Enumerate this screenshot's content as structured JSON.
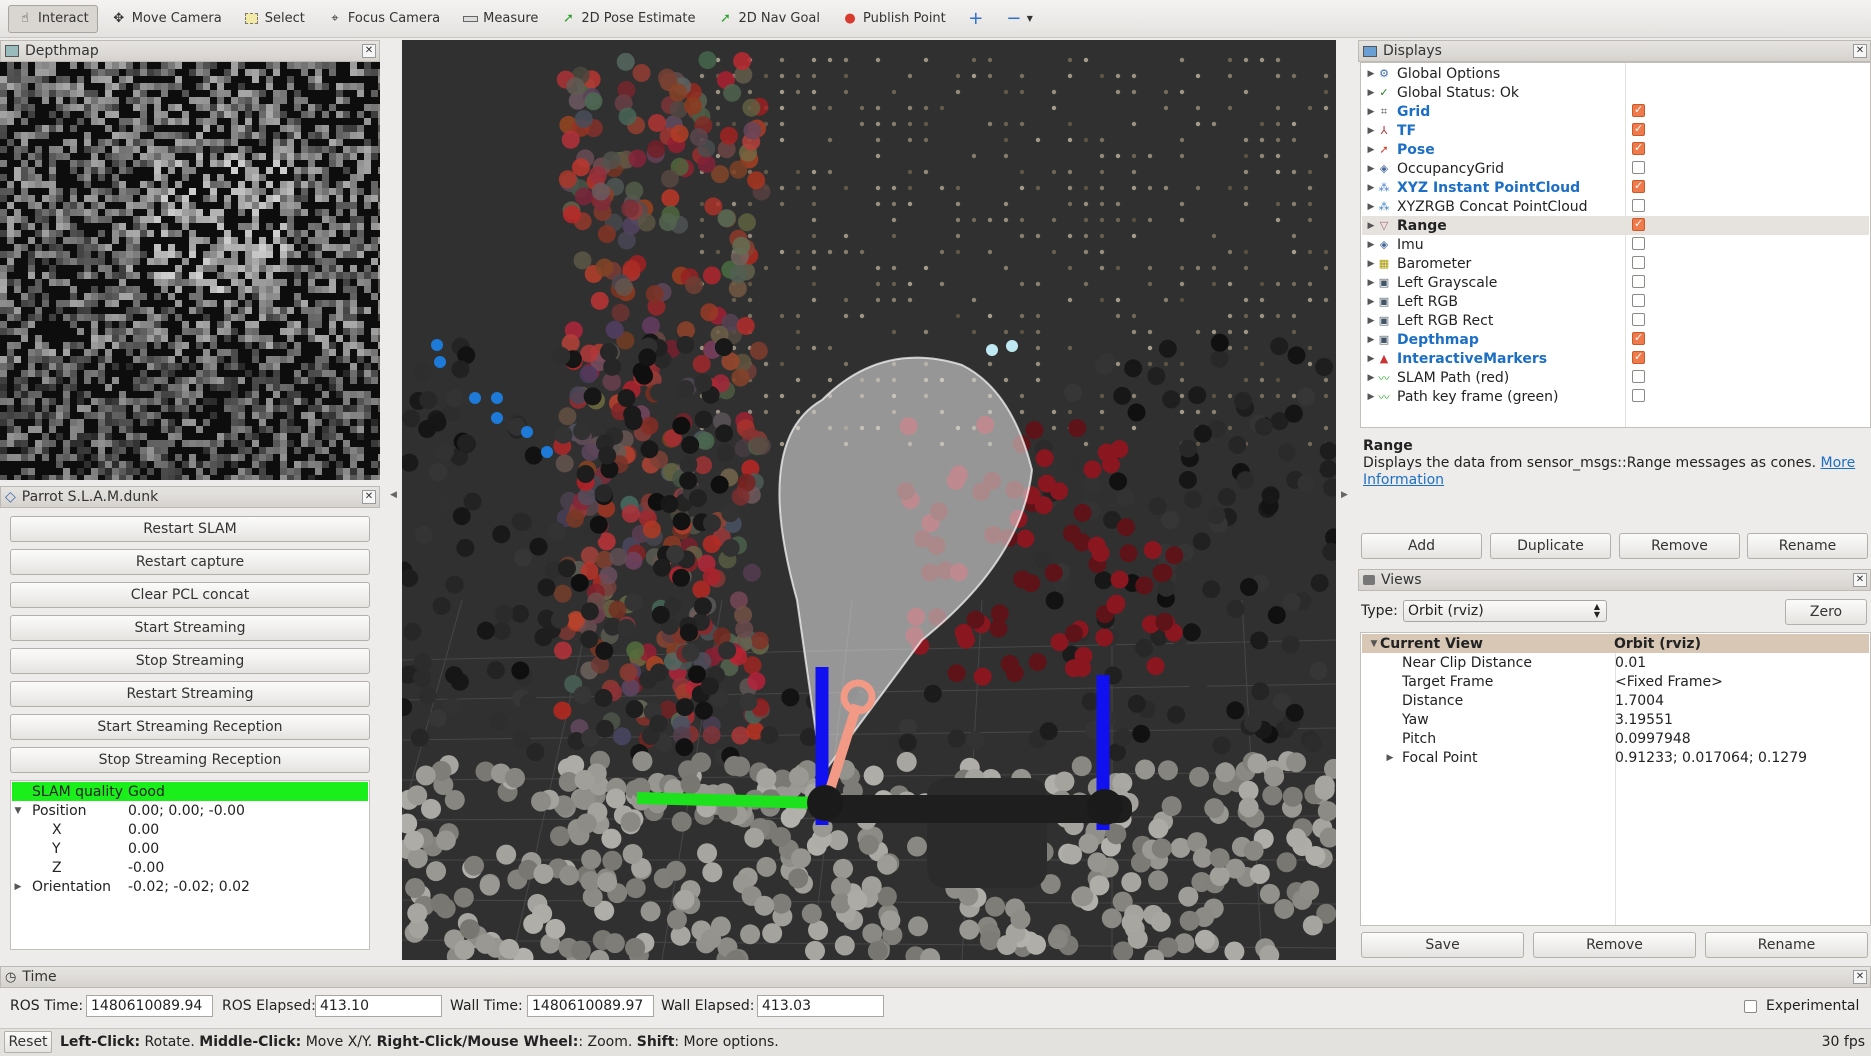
{
  "toolbar": {
    "interact": "Interact",
    "move_camera": "Move Camera",
    "select": "Select",
    "focus_camera": "Focus Camera",
    "measure": "Measure",
    "pose_estimate": "2D Pose Estimate",
    "nav_goal": "2D Nav Goal",
    "publish_point": "Publish Point"
  },
  "depthmap_panel": {
    "title": "Depthmap"
  },
  "slam_panel": {
    "title": "Parrot S.L.A.M.dunk",
    "buttons": [
      "Restart SLAM",
      "Restart capture",
      "Clear PCL concat",
      "Start Streaming",
      "Stop Streaming",
      "Restart Streaming",
      "Start Streaming Reception",
      "Stop Streaming Reception"
    ],
    "tree": [
      {
        "label": "SLAM quality",
        "value": "Good"
      },
      {
        "label": "Position",
        "value": "0.00; 0.00; -0.00"
      },
      {
        "label": "X",
        "value": "0.00"
      },
      {
        "label": "Y",
        "value": "0.00"
      },
      {
        "label": "Z",
        "value": "-0.00"
      },
      {
        "label": "Orientation",
        "value": "-0.02; -0.02; 0.02"
      }
    ]
  },
  "displays": {
    "title": "Displays",
    "items": [
      {
        "label": "Global Options"
      },
      {
        "label": "Global Status: Ok"
      },
      {
        "label": "Grid"
      },
      {
        "label": "TF"
      },
      {
        "label": "Pose"
      },
      {
        "label": "OccupancyGrid"
      },
      {
        "label": "XYZ Instant PointCloud"
      },
      {
        "label": "XYZRGB Concat PointCloud"
      },
      {
        "label": "Range"
      },
      {
        "label": "Imu"
      },
      {
        "label": "Barometer"
      },
      {
        "label": "Left Grayscale"
      },
      {
        "label": "Left RGB"
      },
      {
        "label": "Left RGB Rect"
      },
      {
        "label": "Depthmap"
      },
      {
        "label": "InteractiveMarkers"
      },
      {
        "label": "SLAM Path (red)"
      },
      {
        "label": "Path key frame (green)"
      }
    ],
    "desc_title": "Range",
    "desc_text": "Displays the data from sensor_msgs::Range messages as cones.",
    "desc_link1": "More",
    "desc_link2": "Information",
    "buttons": {
      "add": "Add",
      "duplicate": "Duplicate",
      "remove": "Remove",
      "rename": "Rename"
    }
  },
  "views": {
    "title": "Views",
    "type_label": "Type:",
    "type_value": "Orbit (rviz)",
    "zero": "Zero",
    "header": {
      "name": "Current View",
      "value": "Orbit (rviz)"
    },
    "props": [
      {
        "label": "Near Clip Distance",
        "value": "0.01"
      },
      {
        "label": "Target Frame",
        "value": "<Fixed Frame>"
      },
      {
        "label": "Distance",
        "value": "1.7004"
      },
      {
        "label": "Yaw",
        "value": "3.19551"
      },
      {
        "label": "Pitch",
        "value": "0.0997948"
      },
      {
        "label": "Focal Point",
        "value": "0.91233; 0.017064; 0.1279"
      }
    ],
    "buttons": {
      "save": "Save",
      "remove": "Remove",
      "rename": "Rename"
    }
  },
  "time_panel": {
    "title": "Time",
    "ros_time_label": "ROS Time:",
    "ros_time": "1480610089.94",
    "ros_elapsed_label": "ROS Elapsed:",
    "ros_elapsed": "413.10",
    "wall_time_label": "Wall Time:",
    "wall_time": "1480610089.97",
    "wall_elapsed_label": "Wall Elapsed:",
    "wall_elapsed": "413.03",
    "experimental": "Experimental"
  },
  "status_bar": {
    "reset": "Reset",
    "left_click": "Left-Click:",
    "rotate": " Rotate. ",
    "middle_click": "Middle-Click:",
    "move": " Move X/Y. ",
    "right_click": "Right-Click/Mouse Wheel:",
    "zoom": ": Zoom. ",
    "shift": "Shift",
    "more": ": More options.",
    "fps": "30 fps"
  }
}
